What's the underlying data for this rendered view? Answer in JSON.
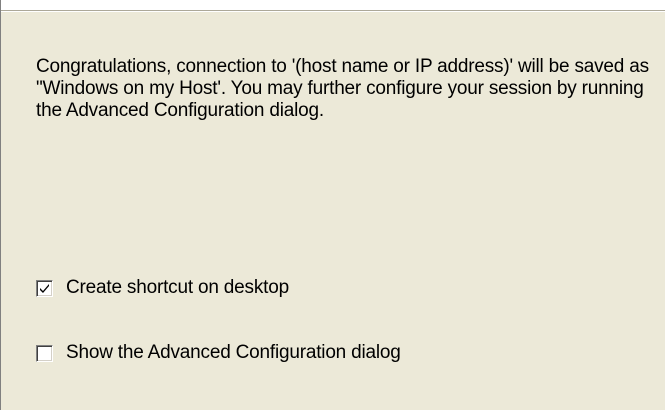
{
  "dialog": {
    "message": "Congratulations, connection to '(host name or IP address)' will be saved as \"Windows on my Host'. You may further configure your session by running the Advanced Configuration dialog.",
    "options": [
      {
        "label": "Create shortcut on desktop",
        "checked": true
      },
      {
        "label": "Show the Advanced Configuration dialog",
        "checked": false
      }
    ]
  },
  "colors": {
    "dialog_background": "#ece9d8",
    "check_mark": "#000000"
  },
  "icons": {
    "check": "check-mark-icon"
  }
}
